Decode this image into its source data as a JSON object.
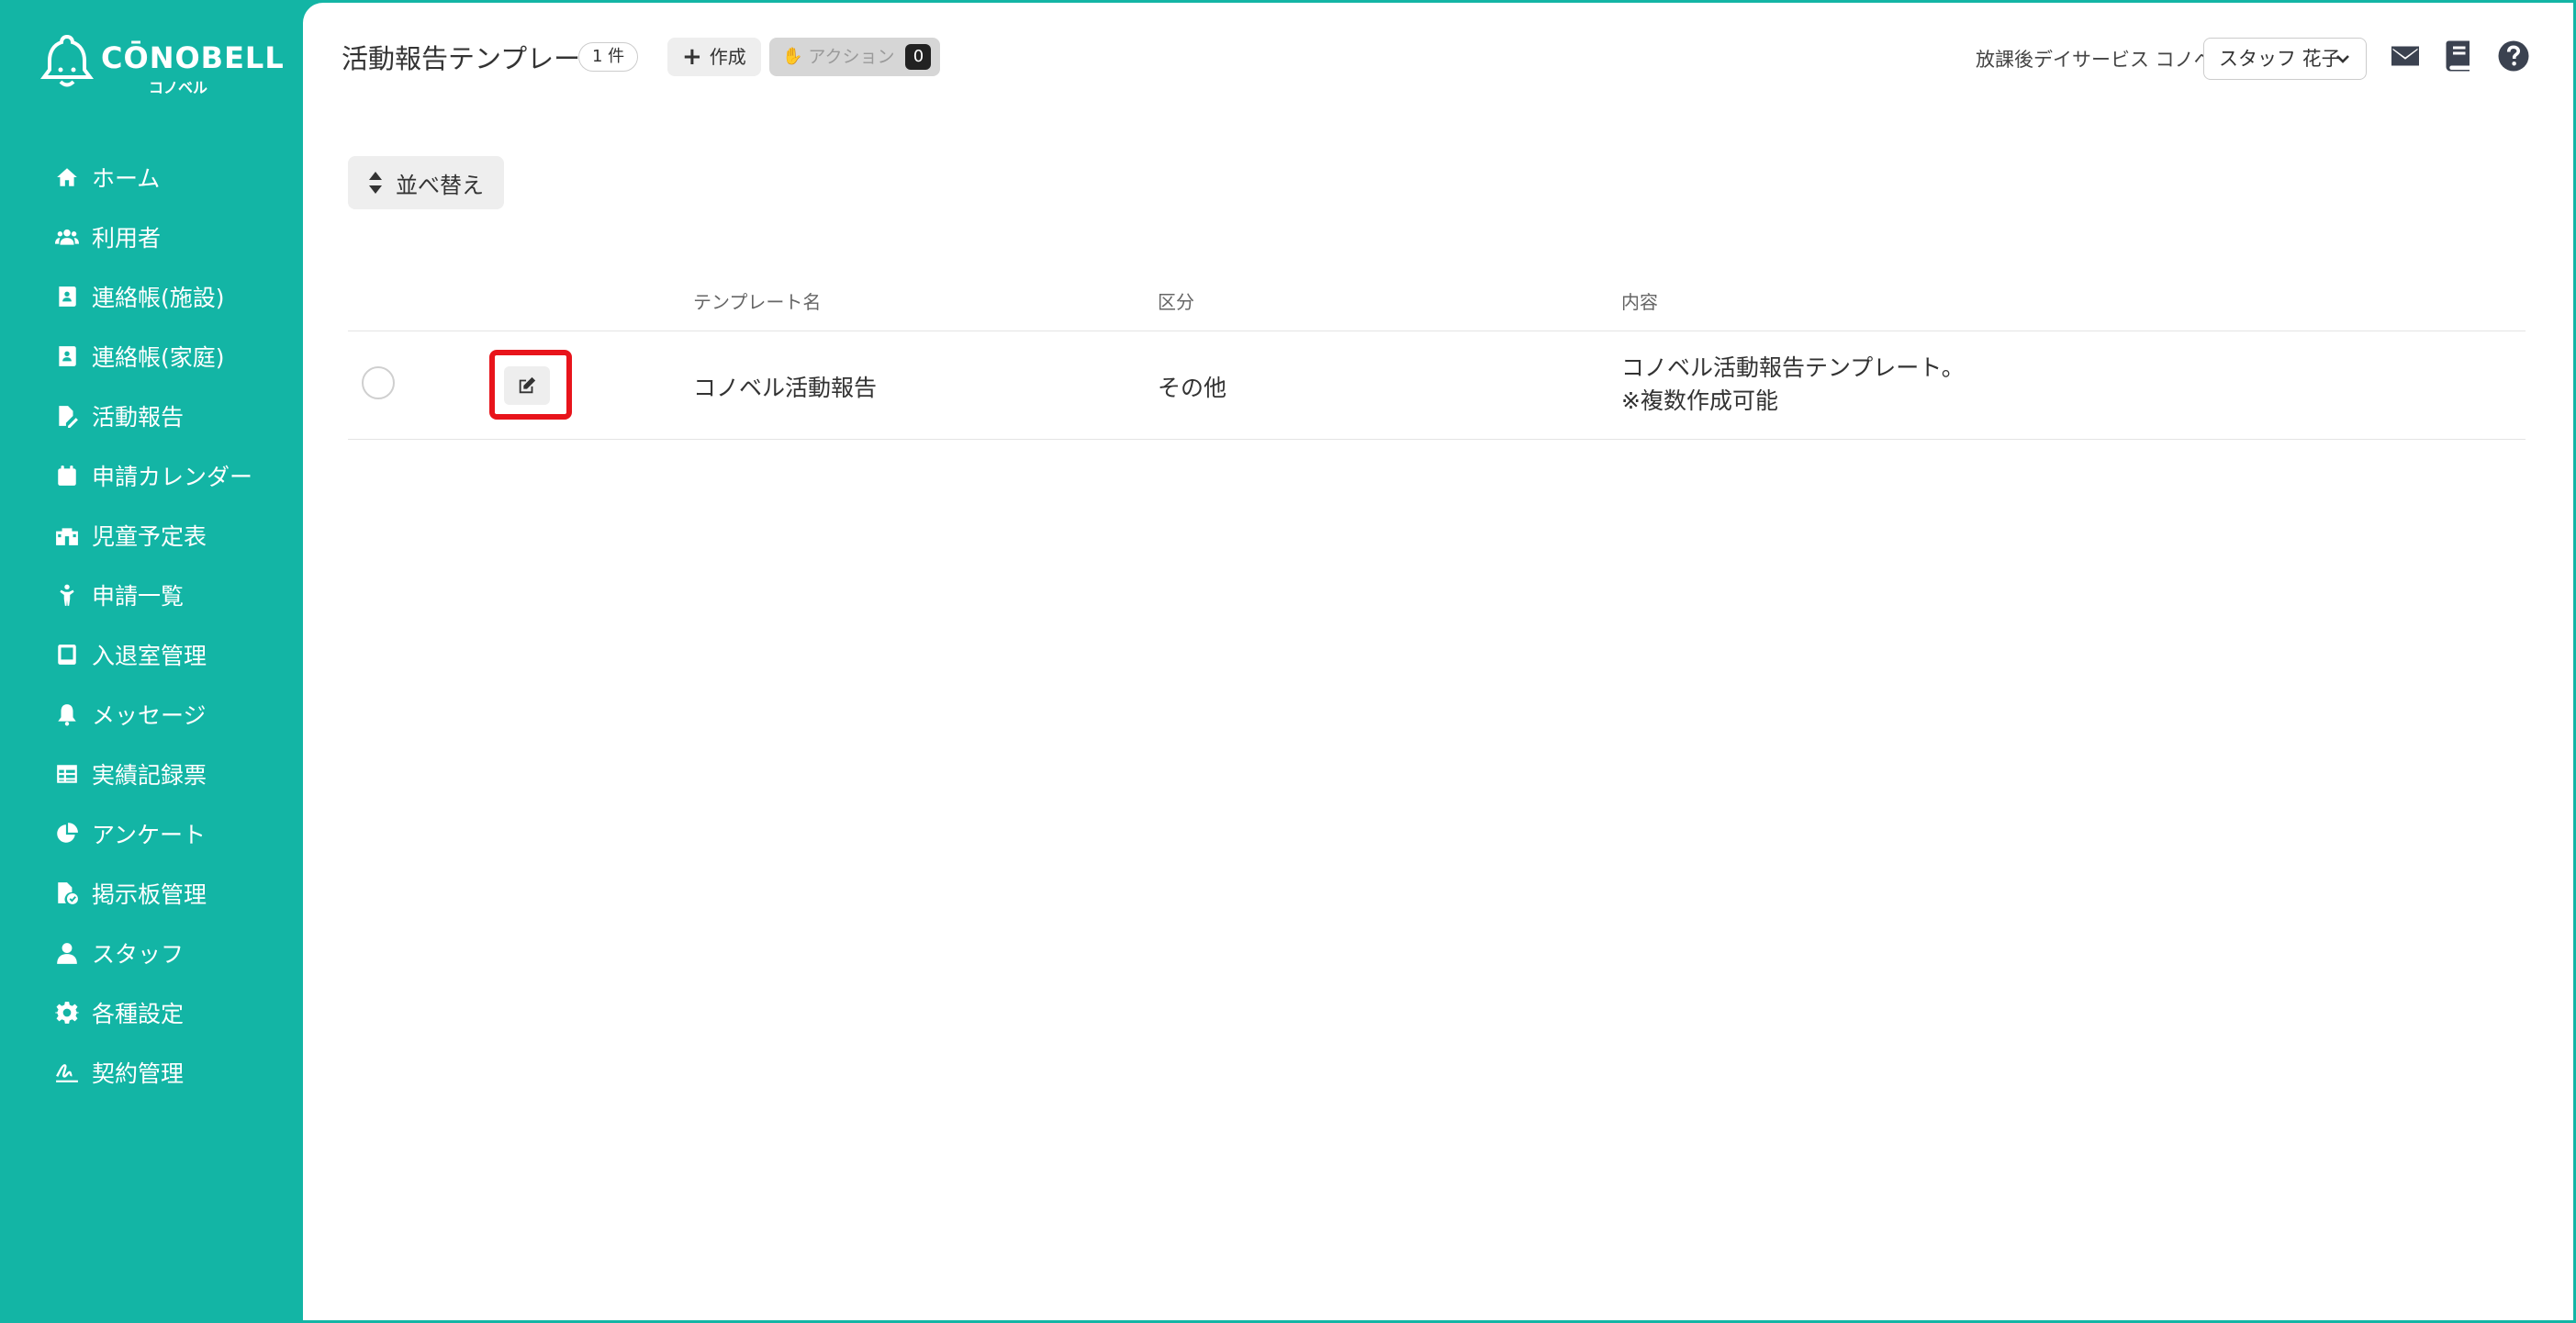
{
  "brand": {
    "name": "CŌNOBELL",
    "subname": "コノベル",
    "color": "#13b5a5"
  },
  "sidebar": {
    "items": [
      {
        "label": "ホーム",
        "icon": "home-icon"
      },
      {
        "label": "利用者",
        "icon": "users-icon"
      },
      {
        "label": "連絡帳(施設)",
        "icon": "contact-book-icon"
      },
      {
        "label": "連絡帳(家庭)",
        "icon": "contact-book-icon"
      },
      {
        "label": "活動報告",
        "icon": "file-edit-icon"
      },
      {
        "label": "申請カレンダー",
        "icon": "calendar-icon"
      },
      {
        "label": "児童予定表",
        "icon": "school-icon"
      },
      {
        "label": "申請一覧",
        "icon": "child-icon"
      },
      {
        "label": "入退室管理",
        "icon": "tablet-icon"
      },
      {
        "label": "メッセージ",
        "icon": "bell-icon"
      },
      {
        "label": "実績記録票",
        "icon": "table-icon"
      },
      {
        "label": "アンケート",
        "icon": "pie-chart-icon"
      },
      {
        "label": "掲示板管理",
        "icon": "file-check-icon"
      },
      {
        "label": "スタッフ",
        "icon": "staff-icon"
      },
      {
        "label": "各種設定",
        "icon": "gear-icon"
      },
      {
        "label": "契約管理",
        "icon": "signature-icon"
      }
    ]
  },
  "header": {
    "title": "活動報告テンプレート",
    "count": "1 件",
    "create_label": "作成",
    "action_label": "アクション",
    "action_count": "0",
    "facility": "放課後デイサービス コノベル",
    "staff": "スタッフ 花子"
  },
  "toolbar": {
    "sort_label": "並べ替え"
  },
  "table": {
    "columns": [
      "テンプレート名",
      "区分",
      "内容"
    ],
    "rows": [
      {
        "name": "コノベル活動報告",
        "category": "その他",
        "content_line1": "コノベル活動報告テンプレート。",
        "content_line2": "※複数作成可能"
      }
    ]
  },
  "highlight_color": "#e8141b"
}
